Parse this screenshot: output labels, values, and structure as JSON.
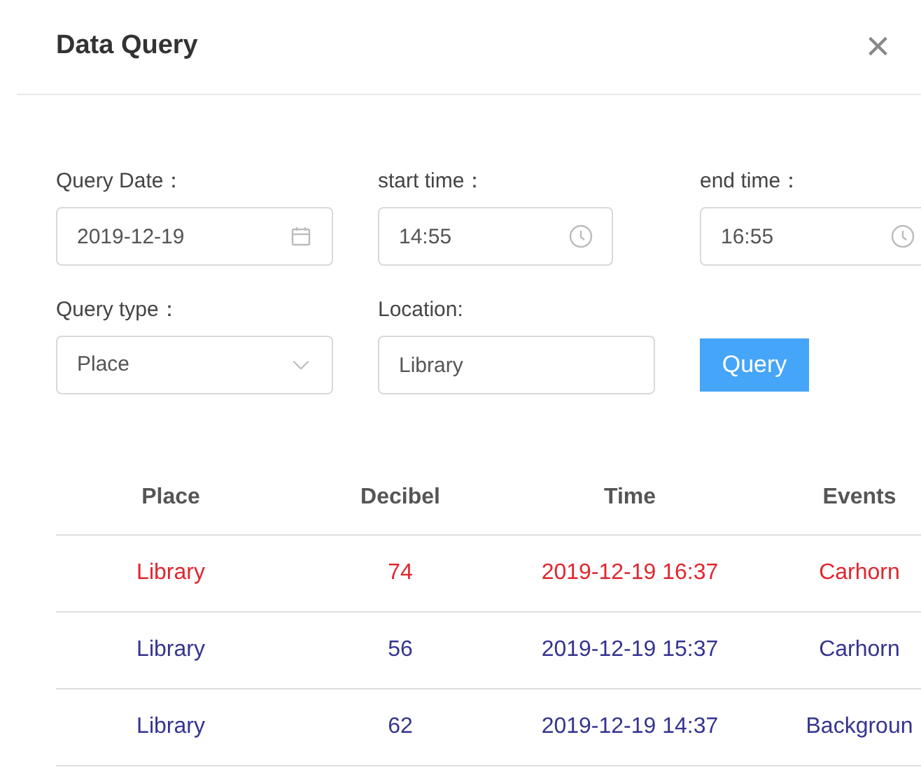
{
  "dialog": {
    "title": "Data Query",
    "close": "×"
  },
  "form": {
    "date": {
      "label": "Query Date：",
      "value": "2019-12-19"
    },
    "start_time": {
      "label": "start time：",
      "value": "14:55"
    },
    "end_time": {
      "label": "end time：",
      "value": "16:55"
    },
    "query_type": {
      "label": "Query type：",
      "value": "Place"
    },
    "location": {
      "label": "Location:",
      "value": "Library"
    },
    "query_button": "Query"
  },
  "table": {
    "columns": [
      "Place",
      "Decibel",
      "Time",
      "Events"
    ],
    "rows": [
      {
        "cells": [
          "Library",
          "74",
          "2019-12-19 16:37",
          "Carhorn"
        ],
        "color": "#e0262f"
      },
      {
        "cells": [
          "Library",
          "56",
          "2019-12-19 15:37",
          "Carhorn"
        ],
        "color": "#35348f"
      },
      {
        "cells": [
          "Library",
          "62",
          "2019-12-19 14:37",
          "Backgroun"
        ],
        "color": "#35348f"
      }
    ]
  }
}
